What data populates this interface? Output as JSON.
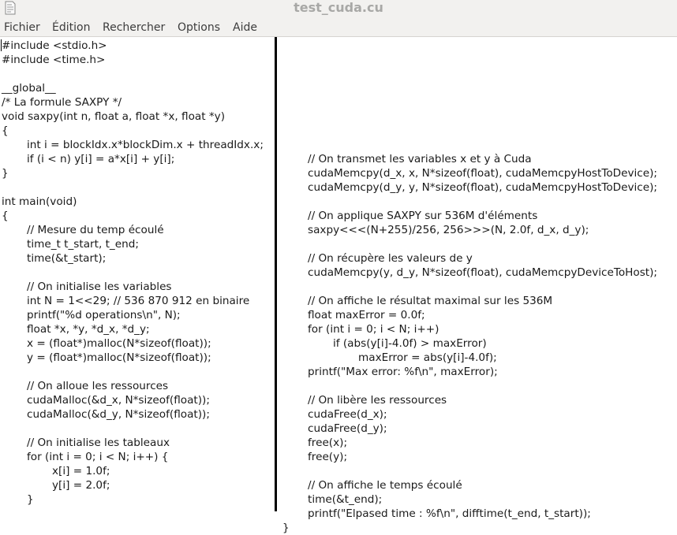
{
  "window": {
    "title": "test_cuda.cu"
  },
  "menubar": {
    "items": [
      "Fichier",
      "Édition",
      "Rechercher",
      "Options",
      "Aide"
    ]
  },
  "editor": {
    "left_pane": [
      {
        "text": "#include <stdio.h>",
        "indent": 0
      },
      {
        "text": "#include <time.h>",
        "indent": 0
      },
      {
        "text": "",
        "indent": 0
      },
      {
        "text": "__global__",
        "indent": 0
      },
      {
        "text": "/* La formule SAXPY */",
        "indent": 0
      },
      {
        "text": "void saxpy(int n, float a, float *x, float *y)",
        "indent": 0
      },
      {
        "text": "{",
        "indent": 0
      },
      {
        "text": "int i = blockIdx.x*blockDim.x + threadIdx.x;",
        "indent": 1
      },
      {
        "text": "if (i < n) y[i] = a*x[i] + y[i];",
        "indent": 1
      },
      {
        "text": "}",
        "indent": 0
      },
      {
        "text": "",
        "indent": 0
      },
      {
        "text": "int main(void)",
        "indent": 0
      },
      {
        "text": "{",
        "indent": 0
      },
      {
        "text": "// Mesure du temp écoulé",
        "indent": 1
      },
      {
        "text": "time_t t_start, t_end;",
        "indent": 1
      },
      {
        "text": "time(&t_start);",
        "indent": 1
      },
      {
        "text": "",
        "indent": 0
      },
      {
        "text": "// On initialise les variables",
        "indent": 1
      },
      {
        "text": "int N = 1<<29; // 536 870 912 en binaire",
        "indent": 1
      },
      {
        "text": "printf(\"%d operations\\n\", N);",
        "indent": 1
      },
      {
        "text": "float *x, *y, *d_x, *d_y;",
        "indent": 1
      },
      {
        "text": "x = (float*)malloc(N*sizeof(float));",
        "indent": 1
      },
      {
        "text": "y = (float*)malloc(N*sizeof(float));",
        "indent": 1
      },
      {
        "text": "",
        "indent": 0
      },
      {
        "text": "// On alloue les ressources",
        "indent": 1
      },
      {
        "text": "cudaMalloc(&d_x, N*sizeof(float));",
        "indent": 1
      },
      {
        "text": "cudaMalloc(&d_y, N*sizeof(float));",
        "indent": 1
      },
      {
        "text": "",
        "indent": 0
      },
      {
        "text": "// On initialise les tableaux",
        "indent": 1
      },
      {
        "text": "for (int i = 0; i < N; i++) {",
        "indent": 1
      },
      {
        "text": "x[i] = 1.0f;",
        "indent": 2
      },
      {
        "text": "y[i] = 2.0f;",
        "indent": 2
      },
      {
        "text": "}",
        "indent": 1
      }
    ],
    "right_pane": [
      {
        "text": "",
        "indent": 0
      },
      {
        "text": "",
        "indent": 0
      },
      {
        "text": "",
        "indent": 0
      },
      {
        "text": "",
        "indent": 0
      },
      {
        "text": "",
        "indent": 0
      },
      {
        "text": "",
        "indent": 0
      },
      {
        "text": "",
        "indent": 0
      },
      {
        "text": "",
        "indent": 0
      },
      {
        "text": "// On transmet les variables x et y à Cuda",
        "indent": 1
      },
      {
        "text": "cudaMemcpy(d_x, x, N*sizeof(float), cudaMemcpyHostToDevice);",
        "indent": 1
      },
      {
        "text": "cudaMemcpy(d_y, y, N*sizeof(float), cudaMemcpyHostToDevice);",
        "indent": 1
      },
      {
        "text": "",
        "indent": 0
      },
      {
        "text": "// On applique SAXPY sur 536M d'éléments",
        "indent": 1
      },
      {
        "text": "saxpy<<<(N+255)/256, 256>>>(N, 2.0f, d_x, d_y);",
        "indent": 1
      },
      {
        "text": "",
        "indent": 0
      },
      {
        "text": "// On récupère les valeurs de y",
        "indent": 1
      },
      {
        "text": "cudaMemcpy(y, d_y, N*sizeof(float), cudaMemcpyDeviceToHost);",
        "indent": 1
      },
      {
        "text": "",
        "indent": 0
      },
      {
        "text": "// On affiche le résultat maximal sur les 536M",
        "indent": 1
      },
      {
        "text": "float maxError = 0.0f;",
        "indent": 1
      },
      {
        "text": "for (int i = 0; i < N; i++)",
        "indent": 1
      },
      {
        "text": "if (abs(y[i]-4.0f) > maxError)",
        "indent": 2
      },
      {
        "text": "maxError = abs(y[i]-4.0f);",
        "indent": 3
      },
      {
        "text": "printf(\"Max error: %f\\n\", maxError);",
        "indent": 1
      },
      {
        "text": "",
        "indent": 0
      },
      {
        "text": "// On libère les ressources",
        "indent": 1
      },
      {
        "text": "cudaFree(d_x);",
        "indent": 1
      },
      {
        "text": "cudaFree(d_y);",
        "indent": 1
      },
      {
        "text": "free(x);",
        "indent": 1
      },
      {
        "text": "free(y);",
        "indent": 1
      },
      {
        "text": "",
        "indent": 0
      },
      {
        "text": "// On affiche le temps écoulé",
        "indent": 1
      },
      {
        "text": "time(&t_end);",
        "indent": 1
      },
      {
        "text": "printf(\"Elpased time : %f\\n\", difftime(t_end, t_start));",
        "indent": 1
      },
      {
        "text": "}",
        "indent": 0
      }
    ]
  }
}
